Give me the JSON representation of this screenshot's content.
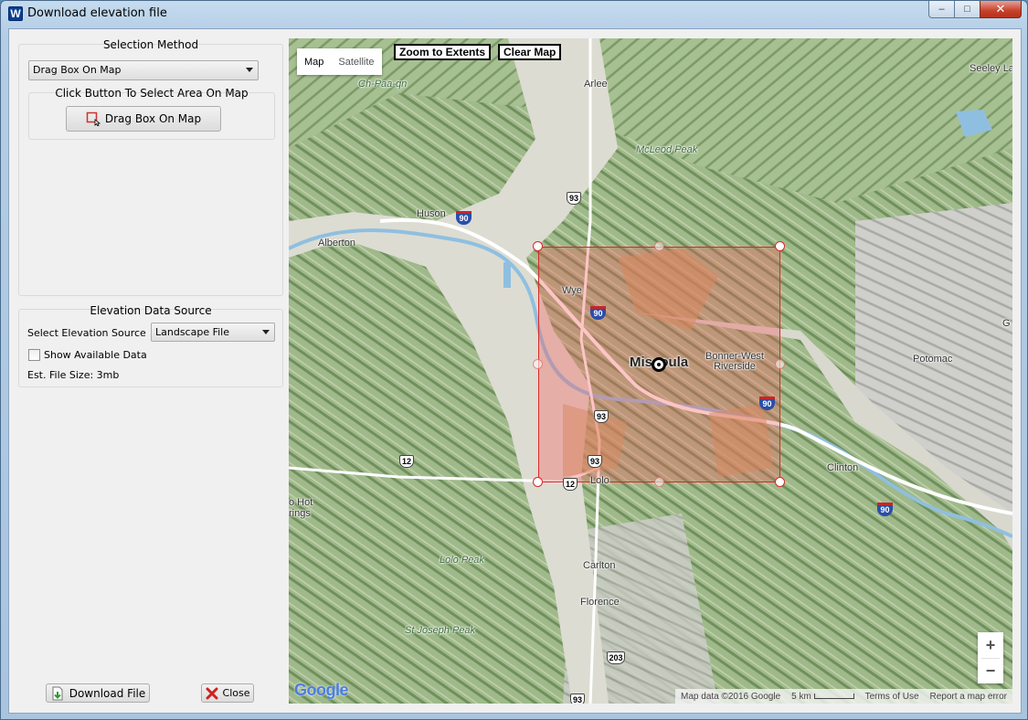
{
  "window": {
    "title": "Download elevation file",
    "app_icon_letter": "W",
    "controls": {
      "minimize": "–",
      "maximize": "□",
      "close": "✕"
    }
  },
  "selection": {
    "heading": "Selection Method",
    "method_value": "Drag Box On Map",
    "subheading": "Click Button To Select Area On Map",
    "drag_button_label": "Drag Box On Map"
  },
  "elevation": {
    "heading": "Elevation Data Source",
    "source_label": "Select Elevation Source",
    "source_value": "Landscape File",
    "show_available_label": "Show Available Data",
    "show_available_checked": false,
    "file_size_text": "Est. File Size: 3mb"
  },
  "footer": {
    "download_label": "Download File",
    "close_label": "Close"
  },
  "map": {
    "type_tabs": [
      "Map",
      "Satellite"
    ],
    "active_type": "Map",
    "zoom_extents_label": "Zoom to Extents",
    "clear_map_label": "Clear Map",
    "zoom_in": "+",
    "zoom_out": "−",
    "logo": "Google",
    "attribution": {
      "map_data": "Map data ©2016 Google",
      "scale": "5 km",
      "terms": "Terms of Use",
      "report": "Report a map error"
    },
    "places": [
      "Arlee",
      "Ch-Paa-qn",
      "McLeod Peak",
      "Seeley La",
      "Huson",
      "Alberton",
      "Wye",
      "Missoula",
      "Bonner-West Riverside",
      "Potomac",
      "Clinton",
      "Lolo",
      "o Hot",
      "rings",
      "Lolo Peak",
      "Carlton",
      "Florence",
      "St Joseph Peak",
      "G"
    ],
    "shields": [
      "93",
      "90",
      "90",
      "93",
      "90",
      "93",
      "12",
      "12",
      "90",
      "203",
      "93"
    ],
    "colors": {
      "selection_fill": "#f65a5a",
      "selection_border": "#d82828"
    }
  }
}
